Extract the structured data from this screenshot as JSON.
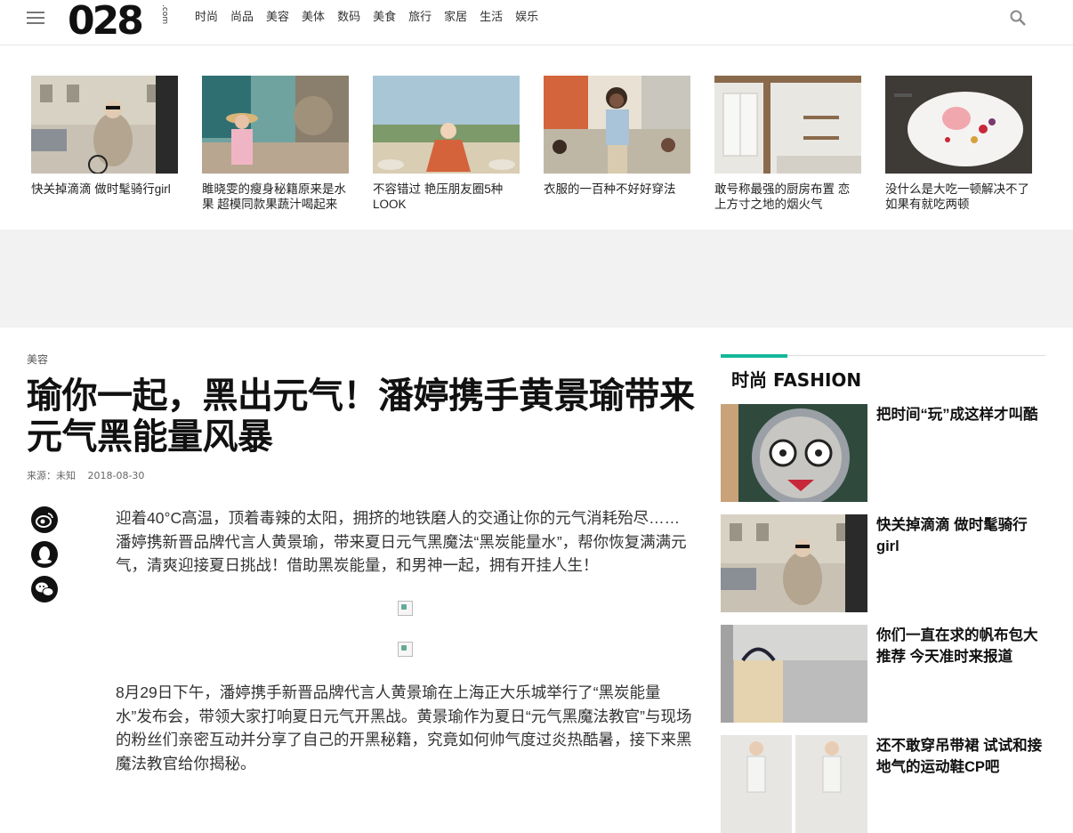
{
  "header": {
    "logo": "028",
    "logo_sub": ".com",
    "nav": [
      "时尚",
      "尚品",
      "美容",
      "美体",
      "数码",
      "美食",
      "旅行",
      "家居",
      "生活",
      "娱乐"
    ]
  },
  "thumbs": [
    {
      "caption": "快关掉滴滴 做时髦骑行girl"
    },
    {
      "caption": "雎晓雯的瘦身秘籍原来是水果 超模同款果蔬汁喝起来"
    },
    {
      "caption": "不容错过 艳压朋友圈5种LOOK"
    },
    {
      "caption": "衣服的一百种不好好穿法"
    },
    {
      "caption": "敢号称最强的厨房布置 恋上方寸之地的烟火气"
    },
    {
      "caption": "没什么是大吃一顿解决不了 如果有就吃两顿"
    }
  ],
  "article": {
    "category": "美容",
    "title": "瑜你一起，黑出元气！潘婷携手黄景瑜带来元气黑能量风暴",
    "source": "来源：未知",
    "date": "2018-08-30",
    "paragraph1": "迎着40°C高温，顶着毒辣的太阳，拥挤的地铁磨人的交通让你的元气消耗殆尽……潘婷携新晋品牌代言人黄景瑜，带来夏日元气黑魔法“黑炭能量水”，帮你恢复满满元气，清爽迎接夏日挑战！借助黑炭能量，和男神一起，拥有开挂人生！",
    "paragraph2": "8月29日下午，潘婷携手新晋品牌代言人黄景瑜在上海正大乐城举行了“黑炭能量水”发布会，带领大家打响夏日元气开黑战。黄景瑜作为夏日“元气黑魔法教官”与现场的粉丝们亲密互动并分享了自己的开黑秘籍，究竟如何帅气度过炎热酷暑，接下来黑魔法教官给你揭秘。"
  },
  "sidebar": {
    "heading": "时尚 FASHION",
    "items": [
      {
        "title": "把时间“玩”成这样才叫酷"
      },
      {
        "title": "快关掉滴滴 做时髦骑行girl"
      },
      {
        "title": "你们一直在求的帆布包大推荐 今天准时来报道"
      },
      {
        "title": "还不敢穿吊带裙 试试和接地气的运动鞋CP吧"
      }
    ]
  },
  "colors": {
    "accent": "#15b79a",
    "adband": "#f2f2f2"
  }
}
